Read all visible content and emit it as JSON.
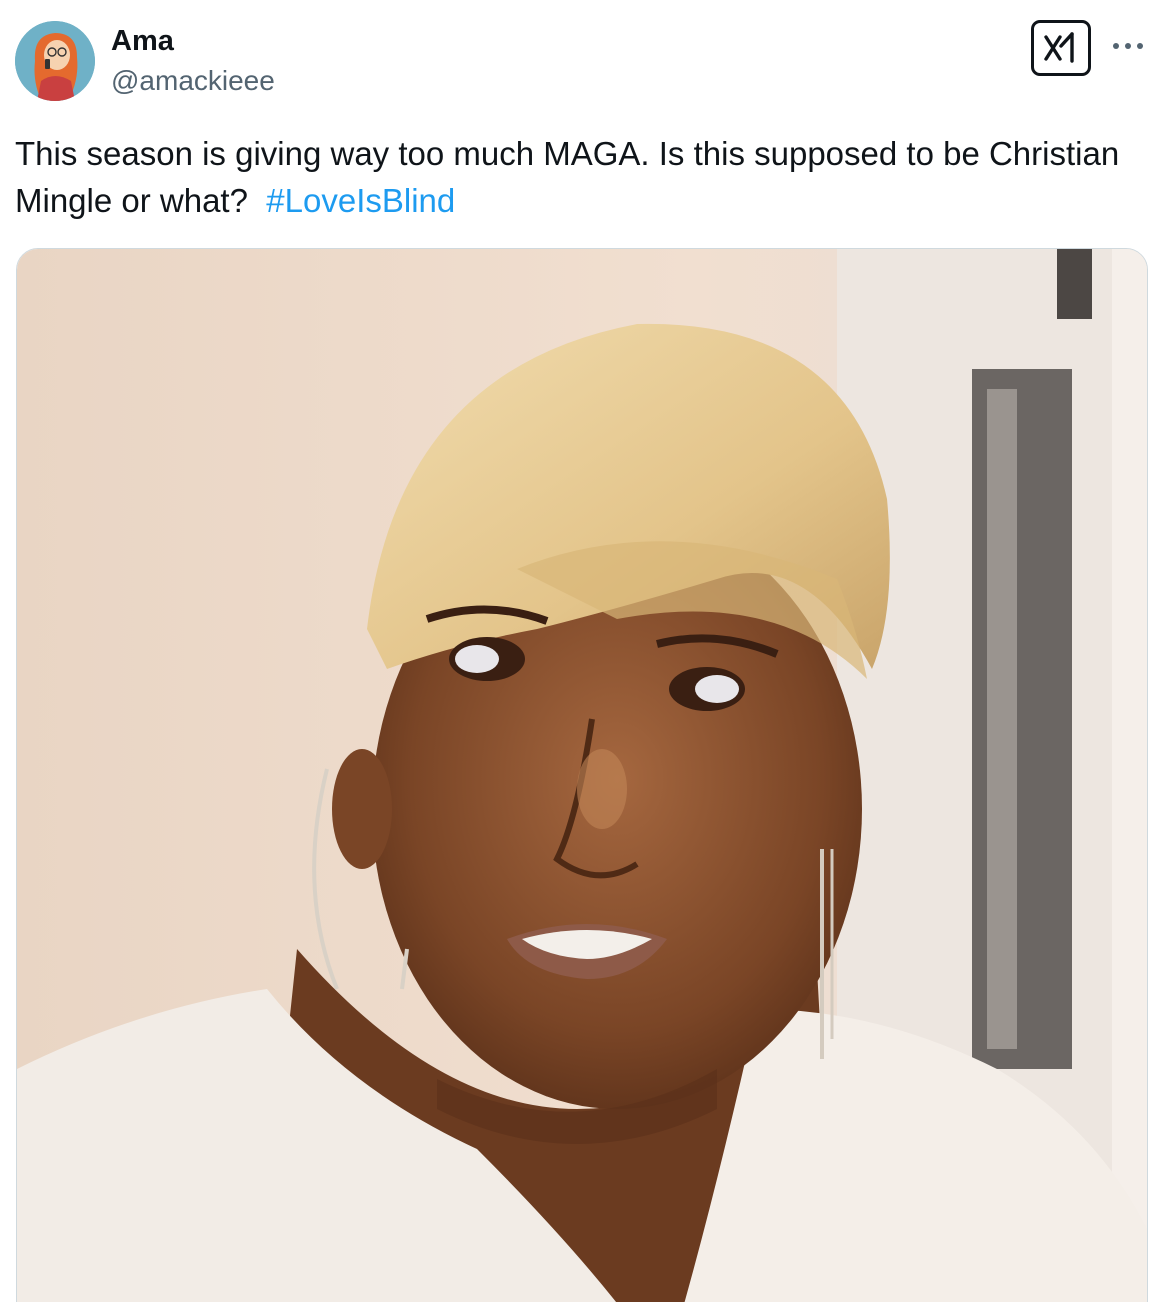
{
  "tweet": {
    "author_name": "Ama",
    "author_handle": "@amackieee",
    "text": "This season is giving way too much MAGA. Is this supposed to be Christian Mingle or what?",
    "hashtag": "#LoveIsBlind",
    "media_alt": "",
    "icons": {
      "avatar": "cartoon-avatar",
      "grok": "grok-icon",
      "more": "more-options-icon"
    }
  },
  "colors": {
    "text": "#0f1419",
    "secondary": "#536471",
    "link": "#1d9bf0",
    "border": "#cfd9de"
  }
}
